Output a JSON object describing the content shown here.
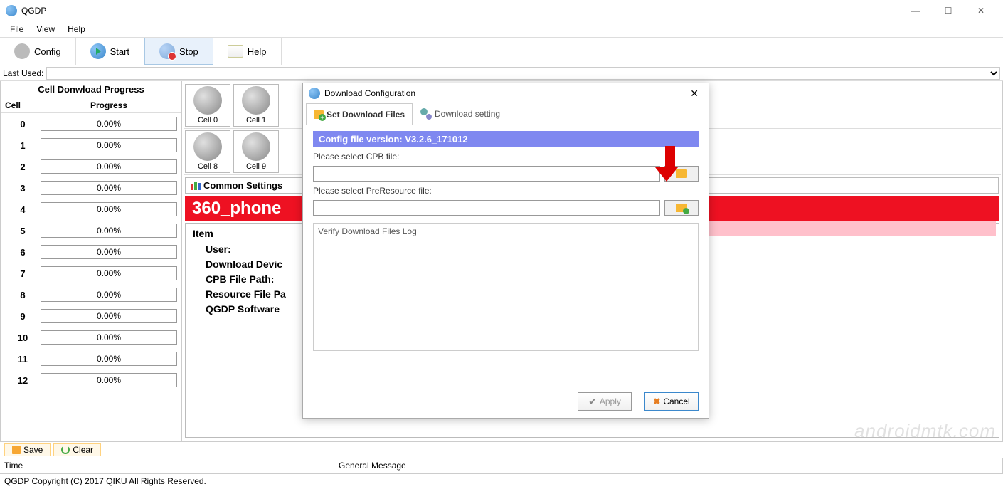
{
  "window": {
    "title": "QGDP",
    "statusbar": "QGDP Copyright (C) 2017 QIKU All Rights Reserved."
  },
  "menubar": [
    "File",
    "View",
    "Help"
  ],
  "toolbar": [
    {
      "label": "Config",
      "name": "config"
    },
    {
      "label": "Start",
      "name": "start"
    },
    {
      "label": "Stop",
      "name": "stop",
      "active": true
    },
    {
      "label": "Help",
      "name": "help"
    }
  ],
  "lastused_label": "Last Used:",
  "left": {
    "title": "Cell Donwload Progress",
    "header_cell": "Cell",
    "header_prog": "Progress",
    "rows": [
      {
        "cell": "0",
        "progress": "0.00%"
      },
      {
        "cell": "1",
        "progress": "0.00%"
      },
      {
        "cell": "2",
        "progress": "0.00%"
      },
      {
        "cell": "3",
        "progress": "0.00%"
      },
      {
        "cell": "4",
        "progress": "0.00%"
      },
      {
        "cell": "5",
        "progress": "0.00%"
      },
      {
        "cell": "6",
        "progress": "0.00%"
      },
      {
        "cell": "7",
        "progress": "0.00%"
      },
      {
        "cell": "8",
        "progress": "0.00%"
      },
      {
        "cell": "9",
        "progress": "0.00%"
      },
      {
        "cell": "10",
        "progress": "0.00%"
      },
      {
        "cell": "11",
        "progress": "0.00%"
      },
      {
        "cell": "12",
        "progress": "0.00%"
      }
    ]
  },
  "cells_top": [
    "Cell 0",
    "Cell 1"
  ],
  "cells_bottom": [
    "Cell 8",
    "Cell 9"
  ],
  "common_settings": "Common Settings",
  "red_banner": "360_phone",
  "item_box": {
    "title": "Item",
    "rows": [
      "User:",
      "Download Devic",
      "CPB File Path:",
      "Resource File Pa",
      "QGDP Software"
    ]
  },
  "saveclear": {
    "save": "Save",
    "clear": "Clear"
  },
  "bottom_table": {
    "time": "Time",
    "msg": "General Message"
  },
  "dialog": {
    "title": "Download Configuration",
    "tabs": {
      "set_files": "Set Download Files",
      "settings": "Download setting"
    },
    "version": "Config file version: V3.2.6_171012",
    "cpb_label": "Please select CPB file:",
    "preres_label": "Please select PreResource file:",
    "log_label": "Verify Download Files Log",
    "apply": "Apply",
    "cancel": "Cancel"
  },
  "watermark": "androidmtk.com"
}
